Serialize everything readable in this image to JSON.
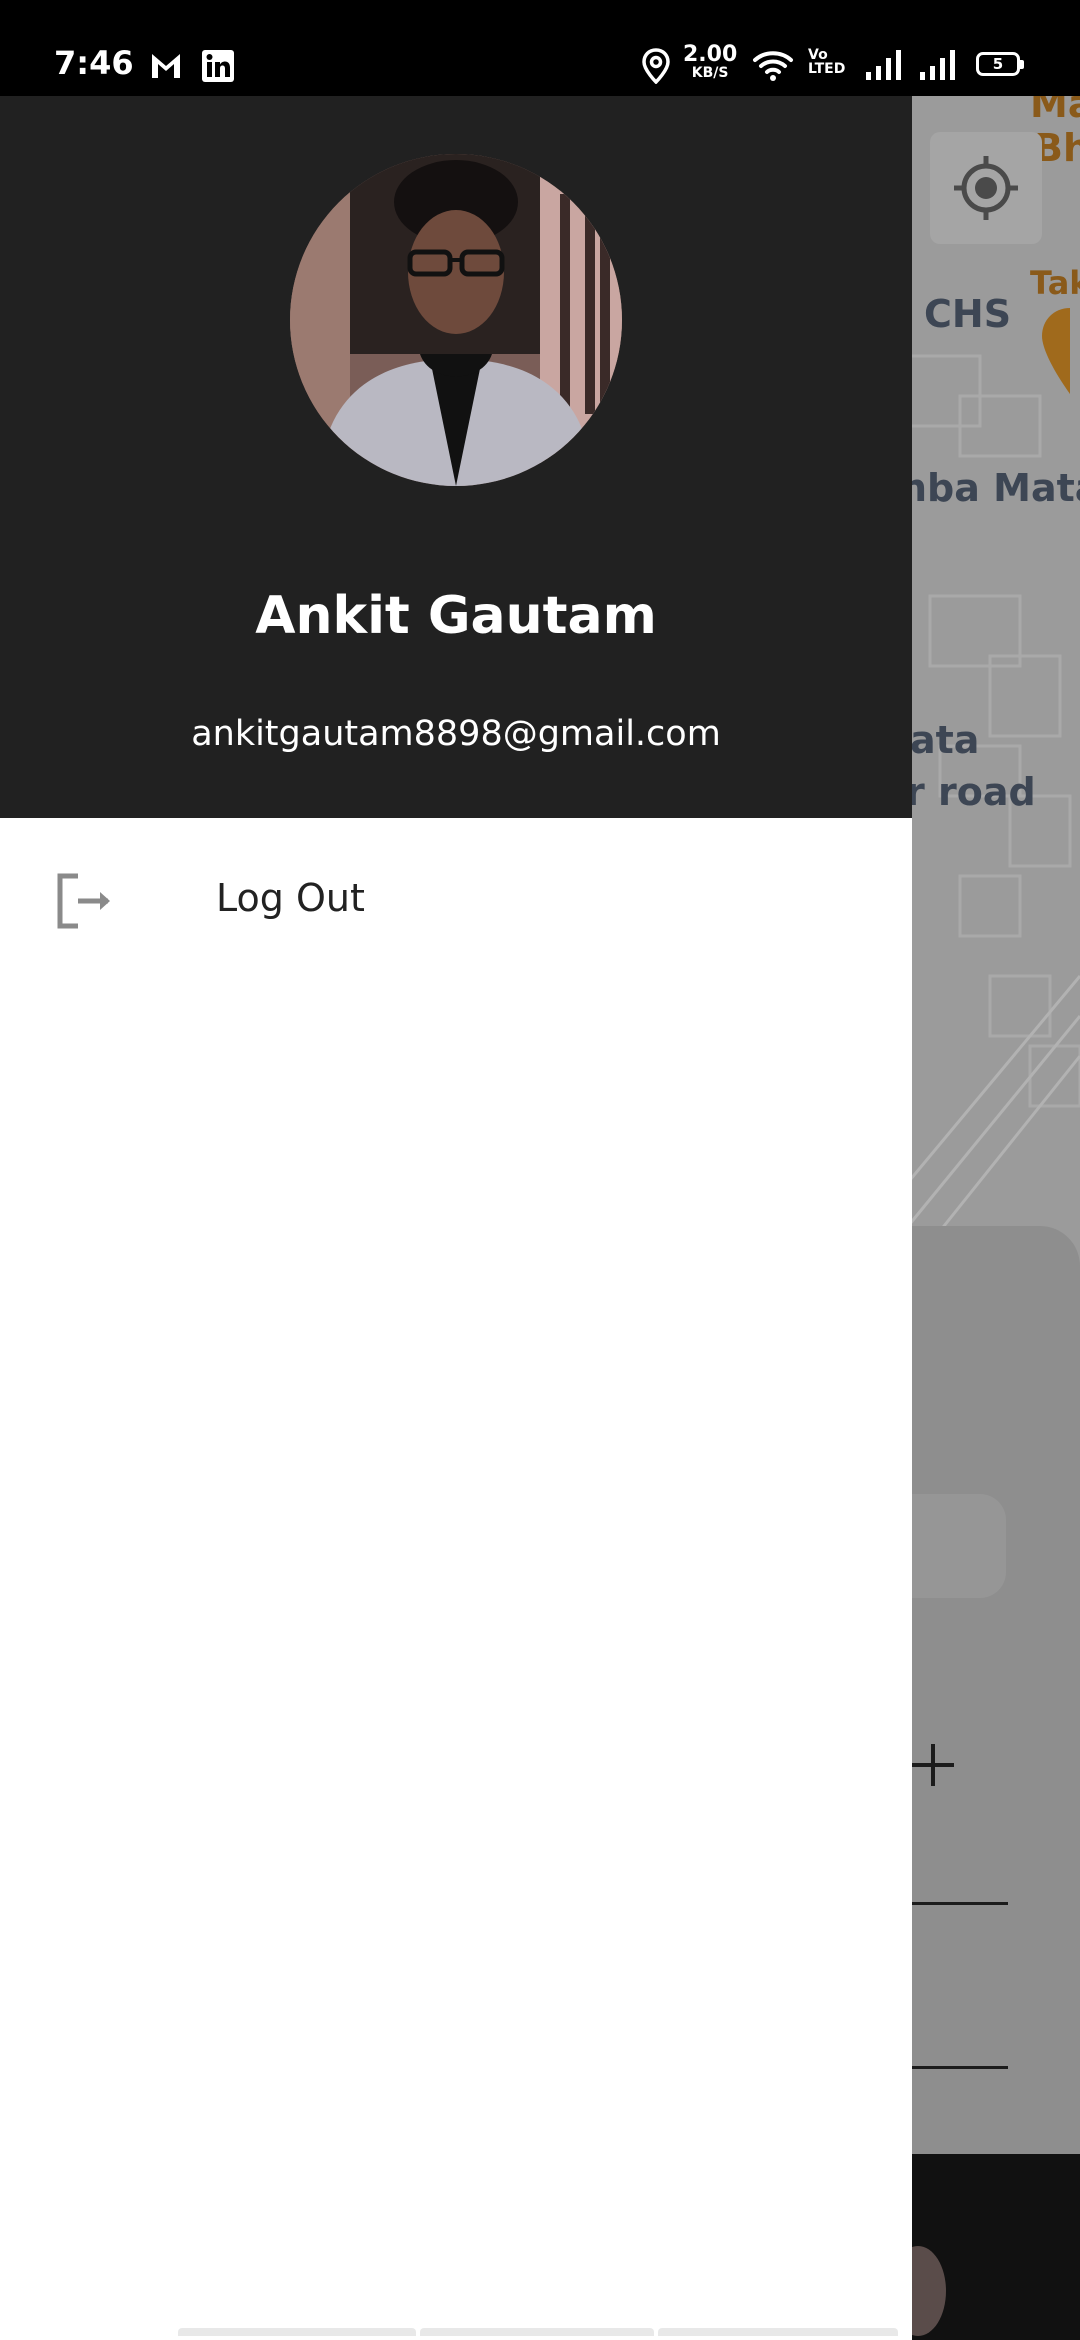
{
  "status_bar": {
    "time": "7:46",
    "network_speed_value": "2.00",
    "network_speed_unit": "KB/S",
    "volte_top": "Vo",
    "volte_bottom": "LTED",
    "battery_level": "5"
  },
  "map": {
    "labels": {
      "top_right": "Ma",
      "top_right_2": "Bh",
      "place_1": "Tak",
      "chs": "CHS",
      "road_1": "nba Mata",
      "road_2": "ata",
      "road_3": "r road"
    }
  },
  "drawer": {
    "profile": {
      "name": "Ankit Gautam",
      "email": "ankitgautam8898@gmail.com"
    },
    "menu_items": [
      {
        "label": "Log Out",
        "icon": "logout-icon"
      }
    ]
  },
  "colors": {
    "drawer_header_bg": "#212121",
    "drawer_bg": "#ffffff",
    "scrim_bg": "#8f8f8f",
    "status_bar_bg": "#000000"
  }
}
